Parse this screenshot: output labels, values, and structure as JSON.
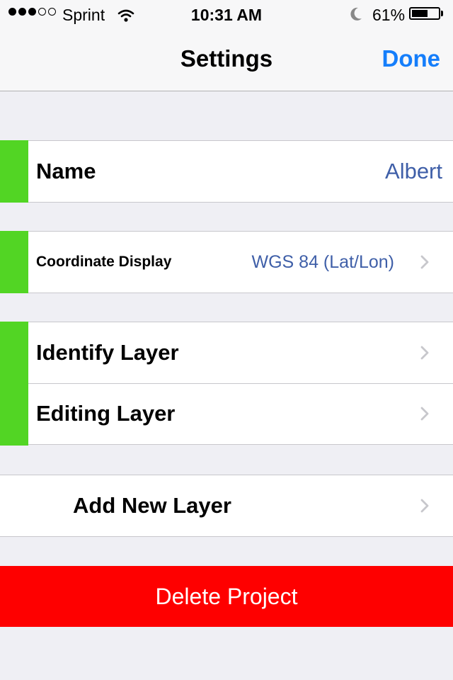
{
  "status_bar": {
    "carrier": "Sprint",
    "time": "10:31 AM",
    "battery_percent": "61%",
    "battery_level": 0.61,
    "signal_bars_filled": 3,
    "signal_bars_total": 5
  },
  "nav": {
    "title": "Settings",
    "done_label": "Done"
  },
  "settings": {
    "name_label": "Name",
    "name_value": "Albert",
    "coordinate_label": "Coordinate Display",
    "coordinate_value": "WGS 84 (Lat/Lon)",
    "identify_label": "Identify Layer",
    "editing_label": "Editing Layer",
    "add_layer_label": "Add New Layer",
    "delete_label": "Delete Project"
  },
  "colors": {
    "accent_blue": "#157efb",
    "value_blue": "#3f5fa8",
    "indicator_green": "#52d524",
    "delete_red": "#fe0000",
    "background": "#efeff4"
  },
  "icons": [
    "wifi-icon",
    "moon-icon",
    "battery-icon",
    "chevron-right-icon"
  ]
}
